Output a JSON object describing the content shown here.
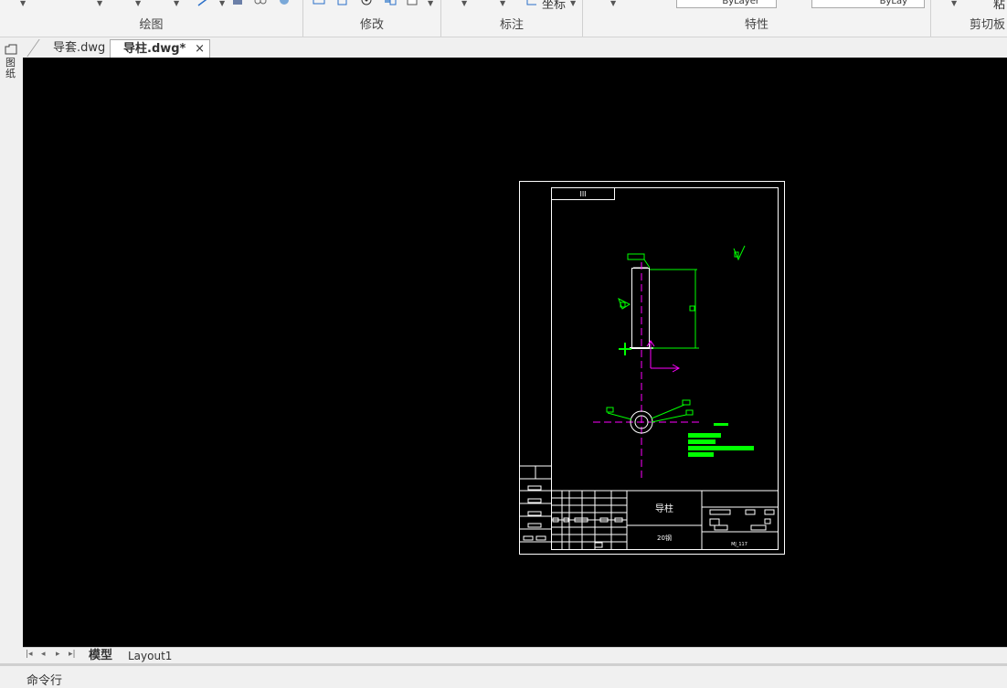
{
  "ribbon": {
    "groups": [
      {
        "label": "绘图"
      },
      {
        "label": "修改"
      },
      {
        "label": "标注"
      },
      {
        "label": "特性"
      },
      {
        "label": "剪切板"
      }
    ],
    "coord_label": "坐标",
    "layer_combo": "ByLayer",
    "linetype_combo": "ByLay",
    "paste_label": "粘"
  },
  "left_toolbar": {
    "label": "图纸"
  },
  "tabs": [
    {
      "label": "导套.dwg",
      "active": false
    },
    {
      "label": "导柱.dwg*",
      "active": true
    }
  ],
  "close_glyph": "×",
  "title_block": {
    "part_name": "导柱",
    "material": "20钢",
    "drawing_code": "MJ_117",
    "corner_code": "III",
    "surface_mark": "III"
  },
  "layout_tabs": [
    {
      "label": "模型",
      "active": true
    },
    {
      "label": "Layout1",
      "active": false
    }
  ],
  "nav_buttons": [
    "|◂",
    "◂",
    "▸",
    "▸|"
  ],
  "command_line": {
    "label": "命令行"
  },
  "colors": {
    "canvas_bg": "#000000",
    "geometry": "#ffffff",
    "dimension": "#00ff00",
    "centerline": "#ff00ff"
  }
}
